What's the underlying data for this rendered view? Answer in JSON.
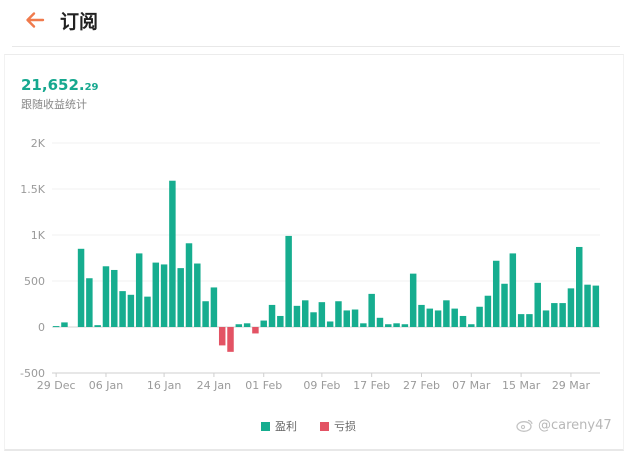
{
  "header": {
    "title": "订阅"
  },
  "summary": {
    "amount_int": "21,652.",
    "amount_dec": "29",
    "label": "跟随收益统计"
  },
  "watermark": {
    "text": "@careny47"
  },
  "colors": {
    "profit": "#16ad8f",
    "loss": "#e35364",
    "accent_back": "#f07a4c",
    "amount": "#16a88f"
  },
  "icons": {
    "back": "arrow-left-icon",
    "watermark": "weibo-logo-icon"
  },
  "chart_data": {
    "type": "bar",
    "title": "",
    "xlabel": "",
    "ylabel": "",
    "ylim": [
      -500,
      2000
    ],
    "yticks": [
      -500,
      0,
      500,
      1000,
      1500,
      2000
    ],
    "ytick_labels": [
      "-500",
      "0",
      "500",
      "1K",
      "1.5K",
      "2K"
    ],
    "x_tick_labels": [
      "29 Dec",
      "06 Jan",
      "16 Jan",
      "24 Jan",
      "01 Feb",
      "09 Feb",
      "17 Feb",
      "27 Feb",
      "07 Mar",
      "15 Mar",
      "29 Mar"
    ],
    "x_tick_index": [
      0,
      6,
      13,
      19,
      25,
      32,
      38,
      44,
      50,
      56,
      62
    ],
    "grid": true,
    "legend_position": "bottom",
    "series": [
      {
        "name": "盈利",
        "color": "#16ad8f"
      },
      {
        "name": "亏损",
        "color": "#e35364"
      }
    ],
    "values": [
      10,
      50,
      0,
      850,
      530,
      20,
      660,
      620,
      390,
      350,
      800,
      330,
      700,
      680,
      1590,
      640,
      910,
      690,
      280,
      430,
      -200,
      -270,
      30,
      40,
      -70,
      70,
      240,
      120,
      990,
      230,
      290,
      160,
      270,
      60,
      280,
      180,
      190,
      40,
      360,
      100,
      30,
      40,
      30,
      580,
      240,
      200,
      180,
      290,
      200,
      120,
      30,
      220,
      340,
      720,
      470,
      800,
      140,
      140,
      480,
      180,
      260,
      260,
      420,
      870,
      460,
      450
    ]
  }
}
